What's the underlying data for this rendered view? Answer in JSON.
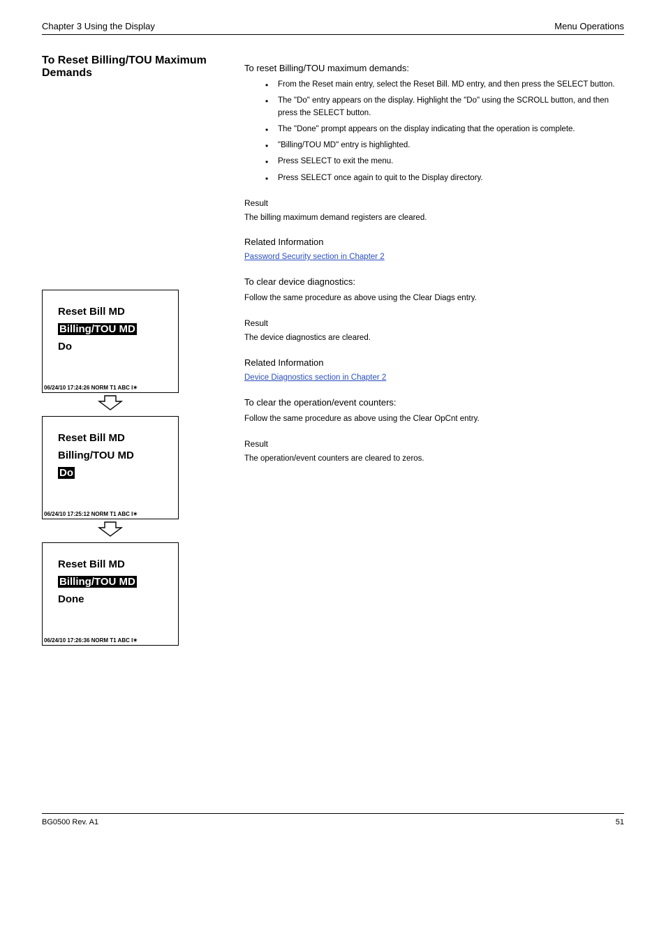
{
  "header": {
    "chapter": "Chapter 3        Using the Display",
    "doc": "Menu Operations"
  },
  "leftHeading": "To Reset Billing/TOU Maximum Demands",
  "panels": [
    {
      "title": "Reset Bill MD",
      "line2": "Billing/TOU MD",
      "line2_highlight": true,
      "action": "Do",
      "action_highlight": false,
      "status": "06/24/10 17:24:26   NORM T1  ABC   I✶"
    },
    {
      "title": "Reset Bill MD",
      "line2": "Billing/TOU MD",
      "line2_highlight": false,
      "action": "Do",
      "action_highlight": true,
      "status": "06/24/10 17:25:12   NORM T1  ABC   I✶"
    },
    {
      "title": "Reset Bill MD",
      "line2": "Billing/TOU MD",
      "line2_highlight": true,
      "action": "Done",
      "action_highlight": false,
      "status": "06/24/10 17:26:36   NORM T1  ABC   I✶"
    }
  ],
  "right": {
    "subhead1": "To reset Billing/TOU maximum demands:",
    "bullets": [
      "From the Reset main entry, select the Reset Bill. MD entry, and then press the SELECT button.",
      "The \"Do\" entry appears on the display. Highlight the \"Do\" using the SCROLL button, and then press the SELECT button.",
      "The \"Done\" prompt appears on the display indicating that the operation is complete.",
      "\"Billing/TOU MD\" entry is highlighted.",
      "Press SELECT to exit the menu.",
      "Press SELECT once again to quit to the Display directory."
    ],
    "rb1_label": "Result",
    "rb1_text": "The billing maximum demand registers are cleared.",
    "rel1_heading": "Related Information",
    "rel1_link": "Password Security section in Chapter 2",
    "subhead2": "To clear device diagnostics:",
    "p2": "Follow the same procedure as above using the Clear Diags entry.",
    "rb2_label": "Result",
    "rb2_text": "The device diagnostics are cleared.",
    "rel2_heading": "Related Information",
    "rel2_link": "Device Diagnostics section in Chapter 2",
    "subhead3": "To clear the operation/event counters:",
    "p3": "Follow the same procedure as above using the Clear OpCnt entry.",
    "rb3_label": "Result",
    "rb3_text": "The operation/event counters are cleared to zeros."
  },
  "footer": {
    "left": "BG0500 Rev. A1",
    "right": "51"
  }
}
